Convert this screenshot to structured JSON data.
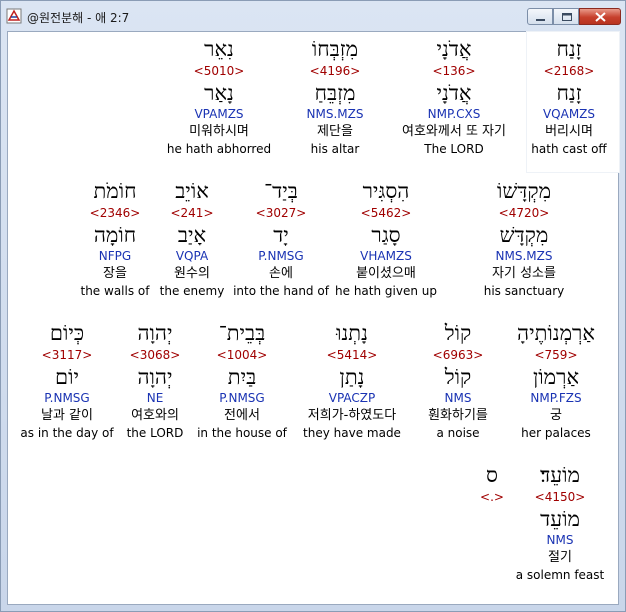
{
  "window": {
    "title": "@원전분해 - 애 2:7"
  },
  "words": [
    {
      "id": "w1",
      "surface": "זָנַח",
      "strongs": "<2168>",
      "lemma": "זָנַח",
      "morph": "VQAMZS",
      "korean": "버리시며",
      "english": "hath cast off"
    },
    {
      "id": "w2",
      "surface": "אֲדֹנָי",
      "strongs": "<136>",
      "lemma": "אֲדֹנָי",
      "morph": "NMP.CXS",
      "korean": "여호와께서 또 자기",
      "english": "The LORD"
    },
    {
      "id": "w3",
      "surface": "מִזְבְּחוֹ",
      "strongs": "<4196>",
      "lemma": "מִזְבֵּחַ",
      "morph": "NMS.MZS",
      "korean": "제단을",
      "english": "his altar"
    },
    {
      "id": "w4",
      "surface": "נִאֵר",
      "strongs": "<5010>",
      "lemma": "נָאַר",
      "morph": "VPAMZS",
      "korean": "미워하시며",
      "english": "he hath abhorred"
    },
    {
      "id": "w5",
      "surface": "מִקְדָּשׁוֹ",
      "strongs": "<4720>",
      "lemma": "מִקְדָּשׁ",
      "morph": "NMS.MZS",
      "korean": "자기 성소를",
      "english": "his sanctuary"
    },
    {
      "id": "w6",
      "surface": "הִסְגִּיר",
      "strongs": "<5462>",
      "lemma": "סָגַר",
      "morph": "VHAMZS",
      "korean": "붙이셨으매",
      "english": "he hath given up"
    },
    {
      "id": "w7",
      "surface": "בְּיַד־",
      "strongs": "<3027>",
      "lemma": "יָד",
      "morph": "P.NMSG",
      "korean": "손에",
      "english": "into the hand of"
    },
    {
      "id": "w8",
      "surface": "אוֹיֵב",
      "strongs": "<241>",
      "lemma": "אָיַב",
      "morph": "VQPA",
      "korean": "원수의",
      "english": "the enemy"
    },
    {
      "id": "w9",
      "surface": "חוֹמֹת",
      "strongs": "<2346>",
      "lemma": "חוֹמָה",
      "morph": "NFPG",
      "korean": "장을",
      "english": "the walls of"
    },
    {
      "id": "w10",
      "surface": "אַרְמְנוֹתֶיהָ",
      "strongs": "<759>",
      "lemma": "אַרְמוֹן",
      "morph": "NMP.FZS",
      "korean": "궁",
      "english": "her palaces"
    },
    {
      "id": "w11",
      "surface": "קוֹל",
      "strongs": "<6963>",
      "lemma": "קוֹל",
      "morph": "NMS",
      "korean": "훤화하기를",
      "english": "a noise"
    },
    {
      "id": "w12",
      "surface": "נָתְנוּ",
      "strongs": "<5414>",
      "lemma": "נָתַן",
      "morph": "VPACZP",
      "korean": "저희가-하였도다",
      "english": "they have made"
    },
    {
      "id": "w13",
      "surface": "בְּבֵית־",
      "strongs": "<1004>",
      "lemma": "בַּיִת",
      "morph": "P.NMSG",
      "korean": "전에서",
      "english": "in the house of"
    },
    {
      "id": "w14",
      "surface": "יְהוָה",
      "strongs": "<3068>",
      "lemma": "יְהוָה",
      "morph": "NE",
      "korean": "여호와의",
      "english": "the LORD"
    },
    {
      "id": "w15",
      "surface": "כְּיוֹם",
      "strongs": "<3117>",
      "lemma": "יוֹם",
      "morph": "P.NMSG",
      "korean": "날과 같이",
      "english": "as in the day of"
    },
    {
      "id": "w16",
      "surface": "מוֹעֵד׃",
      "strongs": "<4150>",
      "lemma": "מוֹעֵד",
      "morph": "NMS",
      "korean": "절기",
      "english": "a solemn feast"
    },
    {
      "id": "w17",
      "surface": "ס",
      "strongs": "<.>",
      "lemma": "",
      "morph": "",
      "korean": "",
      "english": ""
    }
  ]
}
